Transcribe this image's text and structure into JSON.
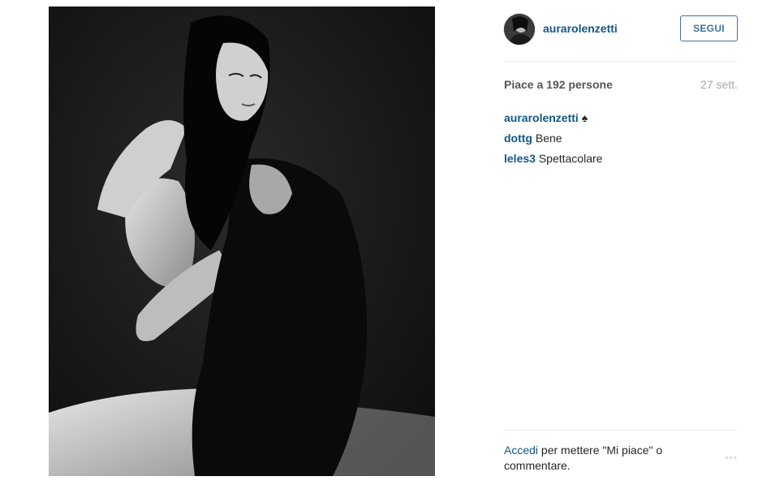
{
  "post": {
    "username": "aurarolenzetti",
    "follow_label": "SEGUI",
    "likes": "Piace a 192 persone",
    "date": "27 sett.",
    "comments": [
      {
        "user": "aurarolenzetti",
        "text": "♠"
      },
      {
        "user": "dottg",
        "text": "Bene"
      },
      {
        "user": "leles3",
        "text": "Spettacolare"
      }
    ],
    "login_link": "Accedi",
    "login_text": "per mettere \"Mi piace\" o commentare.",
    "more_icon": "◦◦◦"
  }
}
